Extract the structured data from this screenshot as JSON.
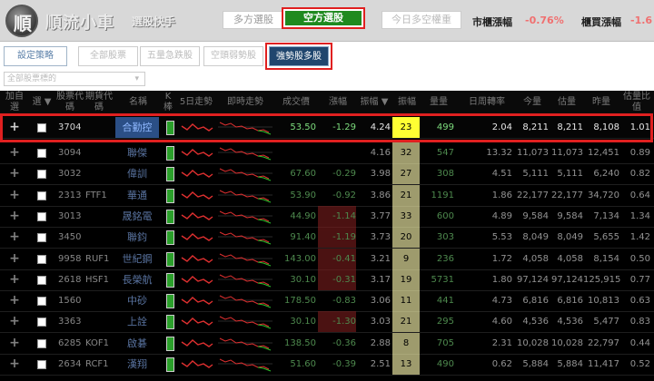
{
  "app": {
    "logo_glyph": "順",
    "title": "順流小車",
    "subtitle": "選股快手",
    "modes": [
      "多方選股",
      "空方選股",
      "今日多空權重"
    ],
    "market_index_label": "市櫃漲幅",
    "market_index_value": "-0.76%",
    "otc_index_label": "櫃買漲幅",
    "otc_index_value": "-1.6",
    "accent_red": "#e02020",
    "short_mode_color": "#1f8a1f"
  },
  "toolbar": {
    "settings": "設定策略",
    "all": "全部股票",
    "up": "五量急跌股",
    "down": "空頭弱勢股",
    "strong": "強勢股多股",
    "select_value": "全部股票標的",
    "select_arrow": "▾"
  },
  "table": {
    "headers": {
      "add": "加自選",
      "check": "選 ▼",
      "code": "股票代碼",
      "futures": "期貨代碼",
      "name": "名稱",
      "k": "K棒",
      "trend5": "5日走勢",
      "trend": "即時走勢",
      "price": "成交價",
      "change": "漲幅",
      "amp": "振幅 ▼",
      "count": "振幅",
      "volume": "量量",
      "turnover": "日周轉率",
      "vol1": "今量",
      "vol2": "估量",
      "vol3": "昨量",
      "ratio": "估量比值"
    },
    "rows": [
      {
        "code": "3704",
        "futures": "",
        "name": "合勤控",
        "price": "53.50",
        "change": "-1.29",
        "amp": "4.24",
        "count": "23",
        "volume": "499",
        "turnover": "2.04",
        "vol1": "8,211",
        "vol2": "8,211",
        "vol3": "8,108",
        "ratio": "1.01"
      },
      {
        "code": "3094",
        "futures": "",
        "name": "聯傑",
        "price": "",
        "change": "",
        "amp": "4.16",
        "count": "32",
        "volume": "547",
        "turnover": "13.32",
        "vol1": "11,073",
        "vol2": "11,073",
        "vol3": "12,451",
        "ratio": "0.89"
      },
      {
        "code": "3032",
        "futures": "",
        "name": "偉訓",
        "price": "67.60",
        "change": "-0.29",
        "amp": "3.98",
        "count": "27",
        "volume": "308",
        "turnover": "4.51",
        "vol1": "5,111",
        "vol2": "5,111",
        "vol3": "6,240",
        "ratio": "0.82"
      },
      {
        "code": "2313",
        "futures": "FTF1",
        "name": "華通",
        "price": "53.90",
        "change": "-0.92",
        "amp": "3.86",
        "count": "21",
        "volume": "1191",
        "turnover": "1.86",
        "vol1": "22,177",
        "vol2": "22,177",
        "vol3": "34,720",
        "ratio": "0.64"
      },
      {
        "code": "3013",
        "futures": "",
        "name": "晟銘電",
        "price": "44.90",
        "change": "-1.14",
        "amp": "3.77",
        "count": "33",
        "volume": "600",
        "turnover": "4.89",
        "vol1": "9,584",
        "vol2": "9,584",
        "vol3": "7,134",
        "ratio": "1.34"
      },
      {
        "code": "3450",
        "futures": "",
        "name": "聯鈞",
        "price": "91.40",
        "change": "-1.19",
        "amp": "3.73",
        "count": "20",
        "volume": "303",
        "turnover": "5.53",
        "vol1": "8,049",
        "vol2": "8,049",
        "vol3": "5,655",
        "ratio": "1.42"
      },
      {
        "code": "9958",
        "futures": "RUF1",
        "name": "世紀鋼",
        "price": "143.00",
        "change": "-0.41",
        "amp": "3.21",
        "count": "9",
        "volume": "236",
        "turnover": "1.72",
        "vol1": "4,058",
        "vol2": "4,058",
        "vol3": "8,154",
        "ratio": "0.50"
      },
      {
        "code": "2618",
        "futures": "HSF1",
        "name": "長榮航",
        "price": "30.10",
        "change": "-0.31",
        "amp": "3.17",
        "count": "19",
        "volume": "5731",
        "turnover": "1.80",
        "vol1": "97,124",
        "vol2": "97,124",
        "vol3": "125,915",
        "ratio": "0.77"
      },
      {
        "code": "1560",
        "futures": "",
        "name": "中砂",
        "price": "178.50",
        "change": "-0.83",
        "amp": "3.06",
        "count": "11",
        "volume": "441",
        "turnover": "4.73",
        "vol1": "6,816",
        "vol2": "6,816",
        "vol3": "10,813",
        "ratio": "0.63"
      },
      {
        "code": "3363",
        "futures": "",
        "name": "上詮",
        "price": "30.10",
        "change": "-1.30",
        "amp": "3.03",
        "count": "21",
        "volume": "295",
        "turnover": "4.60",
        "vol1": "4,536",
        "vol2": "4,536",
        "vol3": "5,477",
        "ratio": "0.83"
      },
      {
        "code": "6285",
        "futures": "KOF1",
        "name": "啟碁",
        "price": "138.50",
        "change": "-0.36",
        "amp": "2.88",
        "count": "8",
        "volume": "705",
        "turnover": "2.31",
        "vol1": "10,028",
        "vol2": "10,028",
        "vol3": "22,797",
        "ratio": "0.44"
      },
      {
        "code": "2634",
        "futures": "RCF1",
        "name": "漢翔",
        "price": "51.60",
        "change": "-0.39",
        "amp": "2.51",
        "count": "13",
        "volume": "490",
        "turnover": "0.62",
        "vol1": "5,884",
        "vol2": "5,884",
        "vol3": "11,417",
        "ratio": "0.52"
      }
    ]
  }
}
